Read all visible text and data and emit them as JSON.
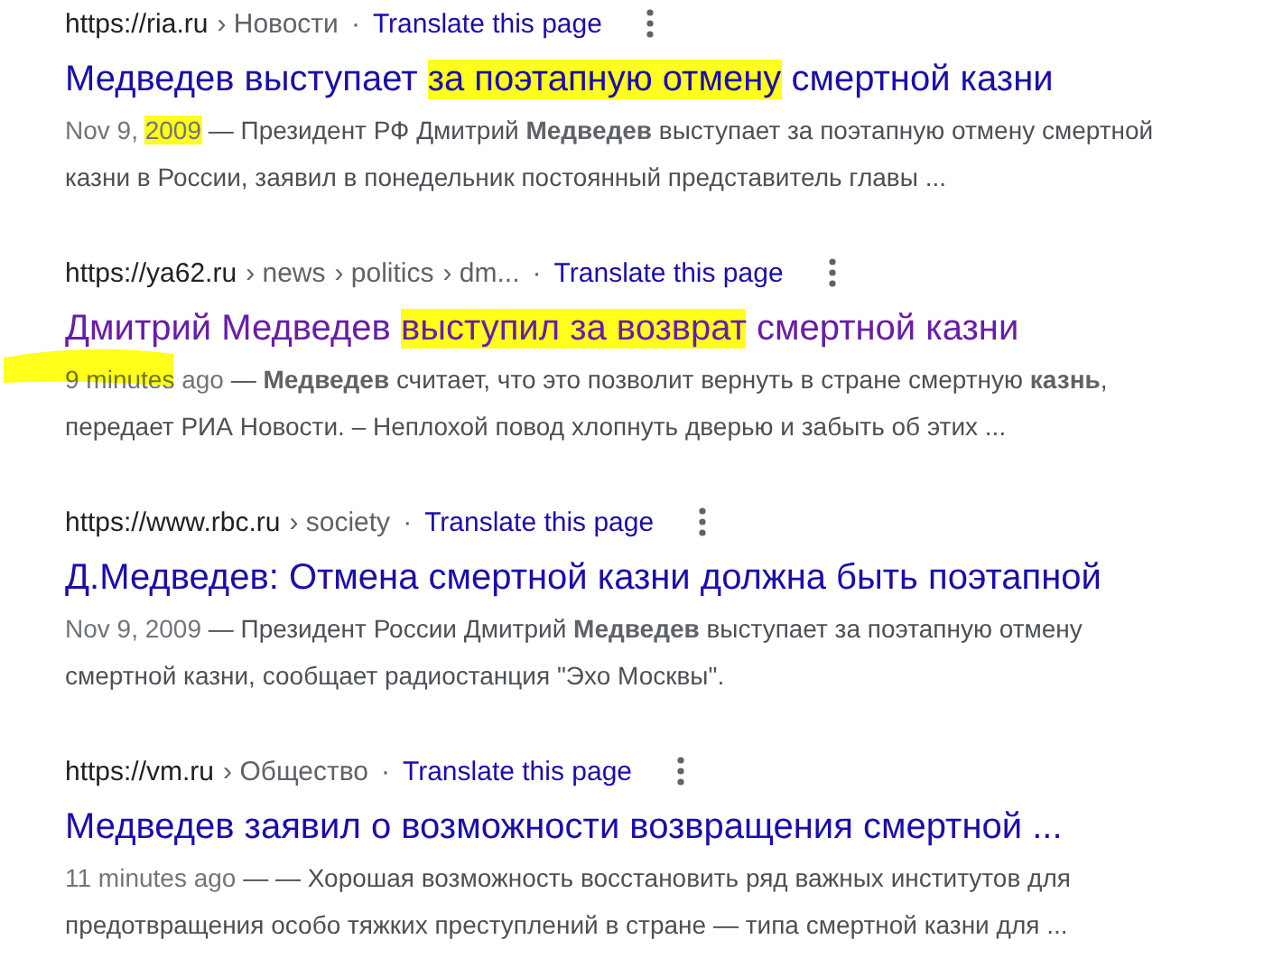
{
  "results": [
    {
      "url": "https://ria.ru",
      "path": [
        "› Новости"
      ],
      "separator": "·",
      "translate": "Translate this page",
      "visited": false,
      "margin_mark": false,
      "title": [
        {
          "text": "Медведев выступает ",
          "highlighted": false
        },
        {
          "text": "за поэтапную отмену",
          "highlighted": true
        },
        {
          "text": " смертной казни",
          "highlighted": false
        }
      ],
      "date": {
        "text": "Nov 9, ",
        "highlighted": false
      },
      "date_mark": {
        "text": "2009",
        "highlighted": true
      },
      "snippet": " — Президент РФ Дмитрий **Медведев** выступает за поэтапную отмену смертной казни в России, заявил в понедельник постоянный представитель главы ..."
    },
    {
      "url": "https://ya62.ru",
      "path": [
        "› news",
        "› politics",
        "› dm..."
      ],
      "separator": "·",
      "translate": "Translate this page",
      "visited": true,
      "margin_mark": true,
      "title": [
        {
          "text": "Дмитрий Медведев ",
          "highlighted": false
        },
        {
          "text": "выступил за возврат",
          "highlighted": true
        },
        {
          "text": " смертной казни",
          "highlighted": false
        }
      ],
      "date": {
        "text": "9 minutes ago",
        "highlighted": false
      },
      "snippet": " — **Медведев** считает, что это позволит вернуть в стране смертную **казнь**, передает РИА Новости. – Неплохой повод хлопнуть дверью и забыть об этих ..."
    },
    {
      "url": "https://www.rbc.ru",
      "path": [
        "› society"
      ],
      "separator": "·",
      "translate": "Translate this page",
      "visited": false,
      "margin_mark": false,
      "title": [
        {
          "text": "Д.Медведев: Отмена смертной казни должна быть поэтапной",
          "highlighted": false
        }
      ],
      "date": {
        "text": "Nov 9, 2009",
        "highlighted": false
      },
      "snippet": " — Президент России Дмитрий **Медведев** выступает за поэтапную отмену смертной казни, сообщает радиостанция \"Эхо Москвы\"."
    },
    {
      "url": "https://vm.ru",
      "path": [
        "› Общество"
      ],
      "separator": "·",
      "translate": "Translate this page",
      "visited": false,
      "margin_mark": false,
      "title": [
        {
          "text": "Медведев заявил о возможности возвращения смертной ...",
          "highlighted": false
        }
      ],
      "date": {
        "text": "11 minutes ago",
        "highlighted": false
      },
      "snippet": " — — Хорошая возможность восстановить ряд важных институтов для предотвращения особо тяжких преступлений в стране — типа смертной казни для ..."
    }
  ]
}
